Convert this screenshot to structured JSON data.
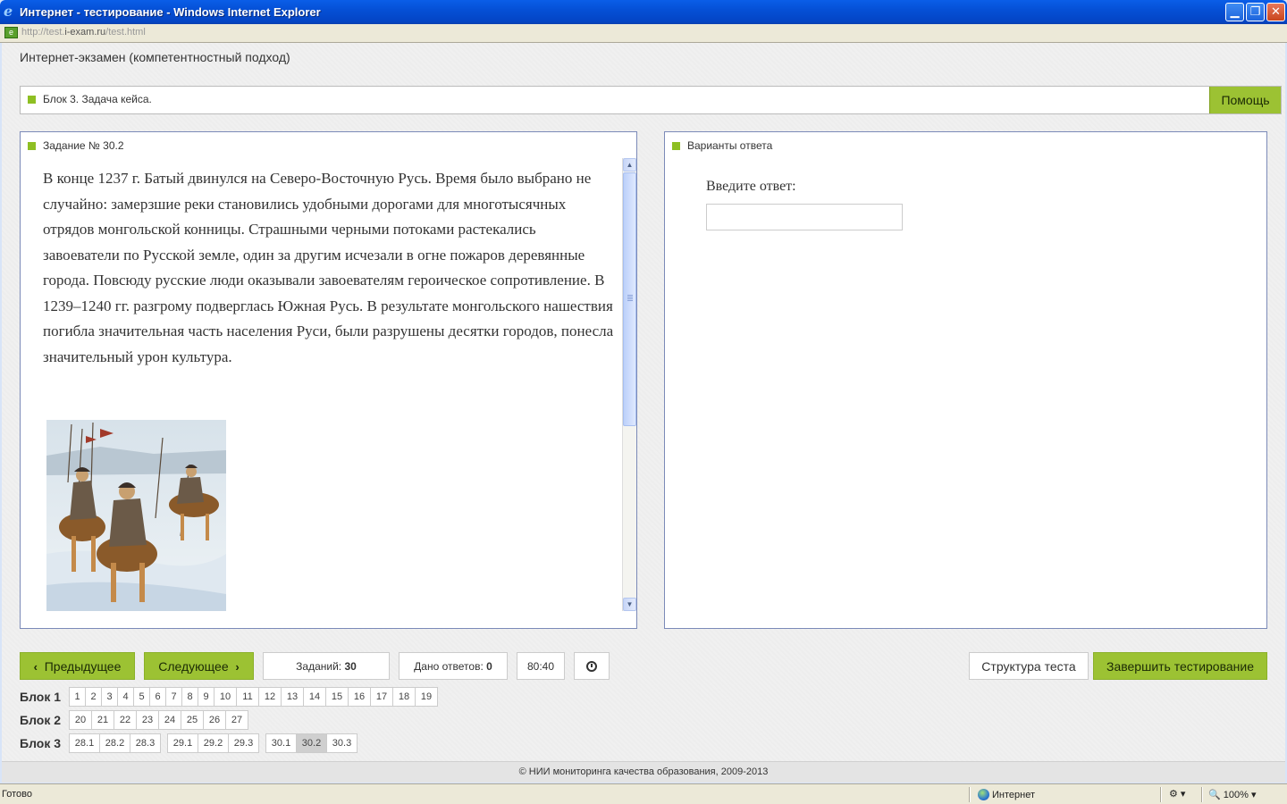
{
  "window": {
    "title": "Интернет - тестирование - Windows Internet Explorer",
    "url_host": "http://test.",
    "url_domain": "i-exam.ru",
    "url_path": "/test.html",
    "minimize_glyph": "▁",
    "maximize_glyph": "❐",
    "close_glyph": "✕"
  },
  "app": {
    "title": "Интернет-экзамен (компетентностный подход)"
  },
  "block_bar": {
    "label": "Блок 3. Задача кейса.",
    "help_label": "Помощь"
  },
  "task": {
    "label": "Задание № 30.2",
    "text": "В конце 1237 г. Батый двинулся на Северо-Восточную Русь. Время было выбрано не случайно: замерзшие реки становились удобными дорогами для многотысячных отрядов монгольской конницы. Страшными черными потоками растекались завоеватели по Русской земле, один за другим исчезали в огне пожаров деревянные города. Повсюду русские люди оказывали завоевателям героическое сопротивление. В 1239–1240 гг. разгрому подверглась Южная Русь. В результате монгольского нашествия погибла значительная часть населения Руси, были разрушены десятки городов, понесла значительный урон культура."
  },
  "answer": {
    "label": "Варианты ответа",
    "prompt": "Введите ответ:",
    "value": ""
  },
  "nav": {
    "prev_label": "Предыдущее",
    "next_label": "Следующее",
    "tasks_label": "Заданий:",
    "tasks_count": "30",
    "answers_label": "Дано ответов:",
    "answers_count": "0",
    "timer": "80:40",
    "structure_label": "Структура теста",
    "finish_label": "Завершить тестирование"
  },
  "blocks": [
    {
      "name": "Блок 1",
      "groups": [
        [
          "1",
          "2",
          "3",
          "4",
          "5",
          "6",
          "7",
          "8",
          "9",
          "10",
          "11",
          "12",
          "13",
          "14",
          "15",
          "16",
          "17",
          "18",
          "19"
        ]
      ]
    },
    {
      "name": "Блок 2",
      "groups": [
        [
          "20",
          "21",
          "22",
          "23",
          "24",
          "25",
          "26",
          "27"
        ]
      ]
    },
    {
      "name": "Блок 3",
      "groups": [
        [
          "28.1",
          "28.2",
          "28.3"
        ],
        [
          "29.1",
          "29.2",
          "29.3"
        ],
        [
          "30.1",
          "30.2",
          "30.3"
        ]
      ]
    }
  ],
  "current_question": "30.2",
  "footer": {
    "text": "© НИИ мониторинга качества образования, 2009-2013"
  },
  "status": {
    "ready": "Готово",
    "zone": "Интернет",
    "zoom": "100%"
  },
  "colors": {
    "accent": "#9cc233",
    "border": "#7b8ab8",
    "current_cell": "#cfcfcf"
  }
}
